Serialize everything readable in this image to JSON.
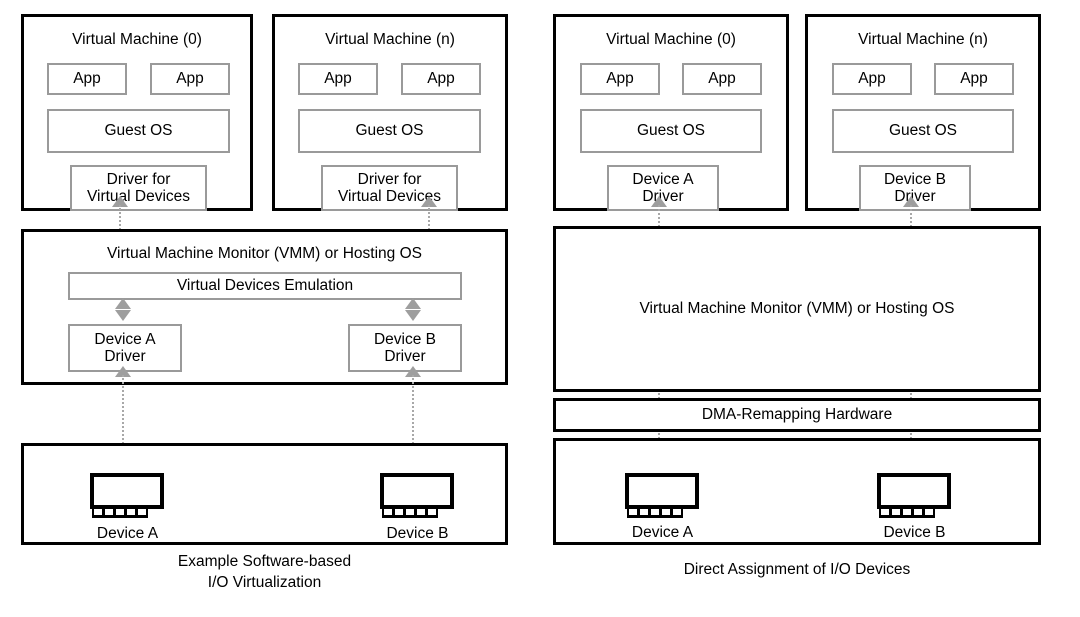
{
  "diagram": {
    "title": "I/O Virtualization Comparison",
    "panels": [
      {
        "id": "software-based",
        "caption_line1": "Example Software-based",
        "caption_line2": "I/O Virtualization",
        "vms": [
          {
            "title": "Virtual Machine (0)",
            "apps": [
              "App",
              "App"
            ],
            "guest_os": "Guest OS",
            "driver_line1": "Driver for",
            "driver_line2": "Virtual Devices"
          },
          {
            "title": "Virtual Machine (n)",
            "apps": [
              "App",
              "App"
            ],
            "guest_os": "Guest OS",
            "driver_line1": "Driver for",
            "driver_line2": "Virtual Devices"
          }
        ],
        "vmm": {
          "title": "Virtual Machine Monitor (VMM) or Hosting OS",
          "emulation": "Virtual Devices Emulation",
          "drivers": [
            {
              "line1": "Device A",
              "line2": "Driver"
            },
            {
              "line1": "Device B",
              "line2": "Driver"
            }
          ]
        },
        "hardware": {
          "devices": [
            {
              "label": "Device A",
              "icon": "pci-card-icon"
            },
            {
              "label": "Device B",
              "icon": "pci-card-icon"
            }
          ]
        }
      },
      {
        "id": "direct-assignment",
        "caption_line1": "Direct Assignment of I/O Devices",
        "caption_line2": "",
        "vms": [
          {
            "title": "Virtual Machine (0)",
            "apps": [
              "App",
              "App"
            ],
            "guest_os": "Guest OS",
            "driver_line1": "Device A",
            "driver_line2": "Driver"
          },
          {
            "title": "Virtual Machine (n)",
            "apps": [
              "App",
              "App"
            ],
            "guest_os": "Guest OS",
            "driver_line1": "Device B",
            "driver_line2": "Driver"
          }
        ],
        "vmm": {
          "title": "Virtual Machine Monitor (VMM) or Hosting OS"
        },
        "dma": {
          "label": "DMA-Remapping Hardware"
        },
        "hardware": {
          "devices": [
            {
              "label": "Device A",
              "icon": "pci-card-icon"
            },
            {
              "label": "Device B",
              "icon": "pci-card-icon"
            }
          ]
        }
      }
    ],
    "colors": {
      "outer_border": "#000000",
      "inner_border": "#9a9a9a",
      "arrow": "#9e9e9e",
      "background": "#ffffff",
      "text": "#000000"
    }
  }
}
